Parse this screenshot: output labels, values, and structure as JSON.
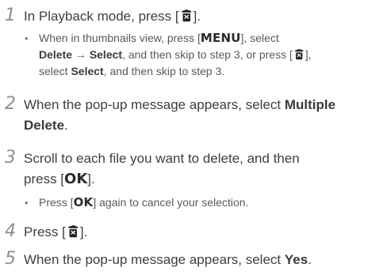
{
  "steps": [
    {
      "number": "1",
      "text_before_icon": "In Playback mode, press [",
      "delete_icon": "trash-delete-icon",
      "text_after_icon": "].",
      "sub_bullets": [
        {
          "dot": "•",
          "part1": "When in thumbnails view, press [",
          "button": "MENU",
          "part2": "], select",
          "bold1": "Delete",
          "arrow": " → ",
          "bold2": "Select",
          "part3": ", and then skip to step 3, or press [",
          "delete_icon": "trash-delete-icon",
          "part4": "],",
          "part5": "select ",
          "bold3": "Select",
          "part6": ", and then skip to step 3."
        }
      ]
    },
    {
      "number": "2",
      "text": "When the pop-up message appears, select ",
      "bold": "Multiple Delete",
      "end": "."
    },
    {
      "number": "3",
      "text_line1": "Scroll to each file you want to delete, and then",
      "text_line2_before": "press [",
      "button": "OK",
      "text_line2_after": "].",
      "sub_bullets": [
        {
          "dot": "•",
          "before": "Press [",
          "button": "OK",
          "after": "] again to cancel your selection."
        }
      ]
    },
    {
      "number": "4",
      "text_before_icon": "Press [",
      "delete_icon": "trash-delete-icon",
      "text_after_icon": "]."
    },
    {
      "number": "5",
      "text": "When the pop-up message appears, select ",
      "bold": "Yes",
      "end": "."
    }
  ]
}
